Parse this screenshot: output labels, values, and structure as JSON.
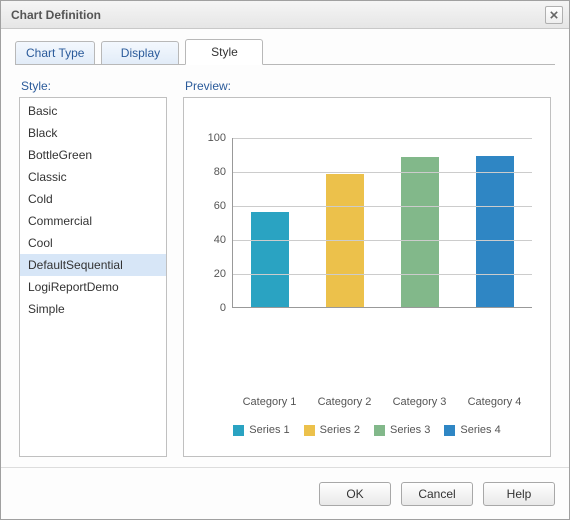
{
  "window": {
    "title": "Chart Definition"
  },
  "tabs": [
    {
      "label": "Chart Type",
      "active": false
    },
    {
      "label": "Display",
      "active": false
    },
    {
      "label": "Style",
      "active": true
    }
  ],
  "style_panel": {
    "label": "Style:",
    "items": [
      {
        "label": "Basic",
        "selected": false
      },
      {
        "label": "Black",
        "selected": false
      },
      {
        "label": "BottleGreen",
        "selected": false
      },
      {
        "label": "Classic",
        "selected": false
      },
      {
        "label": "Cold",
        "selected": false
      },
      {
        "label": "Commercial",
        "selected": false
      },
      {
        "label": "Cool",
        "selected": false
      },
      {
        "label": "DefaultSequential",
        "selected": true
      },
      {
        "label": "LogiReportDemo",
        "selected": false
      },
      {
        "label": "Simple",
        "selected": false
      }
    ]
  },
  "preview": {
    "label": "Preview:"
  },
  "chart_data": {
    "type": "bar",
    "categories": [
      "Category 1",
      "Category 2",
      "Category 3",
      "Category 4"
    ],
    "values": [
      56,
      78,
      88,
      89
    ],
    "series_labels": [
      "Series 1",
      "Series 2",
      "Series 3",
      "Series 4"
    ],
    "colors": [
      "#2aa3c2",
      "#ecc14b",
      "#82b88a",
      "#2f86c4"
    ],
    "ylim": [
      0,
      100
    ],
    "yticks": [
      0,
      20,
      40,
      60,
      80,
      100
    ],
    "title": "",
    "xlabel": "",
    "ylabel": ""
  },
  "buttons": {
    "ok": "OK",
    "cancel": "Cancel",
    "help": "Help"
  }
}
